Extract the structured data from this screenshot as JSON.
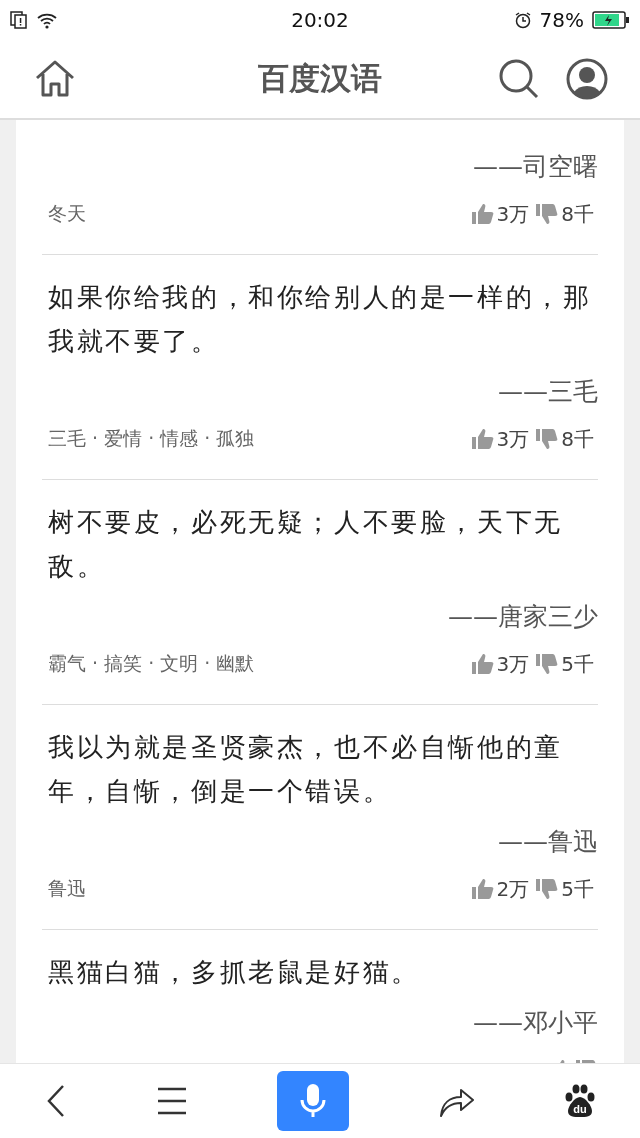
{
  "status_bar": {
    "time": "20:02",
    "battery": "78%"
  },
  "header": {
    "title": "百度汉语"
  },
  "quotes": [
    {
      "author": "——司空曙",
      "tags": "冬天",
      "likes": "3万",
      "dislikes": "8千"
    },
    {
      "text": "如果你给我的，和你给别人的是一样的，那我就不要了。",
      "author": "——三毛",
      "tags": "三毛 · 爱情 · 情感 · 孤独",
      "likes": "3万",
      "dislikes": "8千"
    },
    {
      "text": "树不要皮，必死无疑；人不要脸，天下无敌。",
      "author": "——唐家三少",
      "tags": "霸气 · 搞笑 · 文明 · 幽默",
      "likes": "3万",
      "dislikes": "5千"
    },
    {
      "text": "我以为就是圣贤豪杰，也不必自惭他的童年，自惭，倒是一个错误。",
      "author": "——鲁迅",
      "tags": "鲁迅",
      "likes": "2万",
      "dislikes": "5千"
    },
    {
      "text": "黑猫白猫，多抓老鼠是好猫。",
      "author": "——邓小平"
    }
  ],
  "bottom_bar": {
    "logo_text": "du"
  }
}
